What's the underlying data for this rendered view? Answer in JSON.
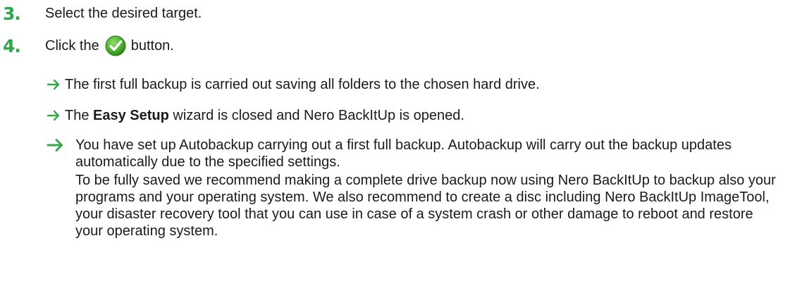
{
  "steps": [
    {
      "number": "3.",
      "text": "Select the desired target."
    },
    {
      "number": "4.",
      "text_before": "Click the",
      "text_after": "button.",
      "icon": "green-checkmark-icon"
    }
  ],
  "results": [
    {
      "text": "The first full backup is carried out saving all folders to the chosen hard drive."
    },
    {
      "before": "The ",
      "bold": "Easy Setup",
      "after": " wizard is closed and Nero BackItUp is opened."
    }
  ],
  "final_result": {
    "paragraph1": "You have set up Autobackup carrying out a first full backup. Autobackup will carry out the backup updates automatically due to the specified settings.",
    "paragraph2": "To be fully saved we recommend making a complete drive backup now using Nero BackItUp to backup also your programs and your operating system. We also recommend to create a disc including Nero BackItUp ImageTool, your disaster recovery tool that you can use in case of a system crash or other damage to reboot and restore your operating system."
  },
  "colors": {
    "step_number": "#2aa84a",
    "arrow": "#3aa64a",
    "check_icon": "#4caf2e"
  }
}
